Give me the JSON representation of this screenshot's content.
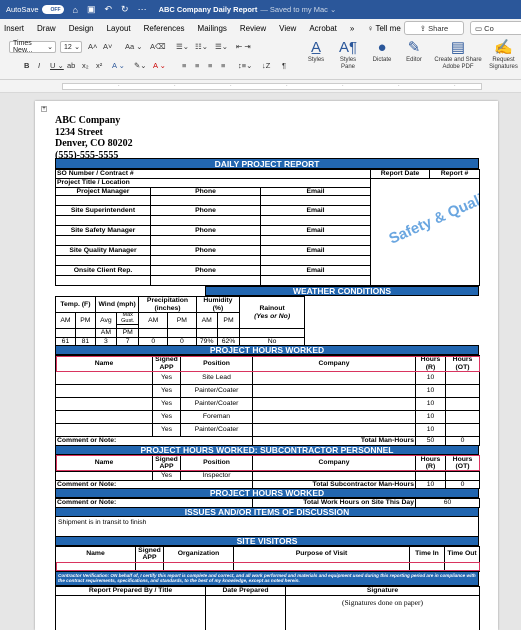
{
  "titlebar": {
    "autosave": "AutoSave",
    "autosave_state": "OFF",
    "doc_title": "ABC Company Daily Report",
    "saved_text": "— Saved to my Mac ⌄"
  },
  "menu": {
    "tabs": [
      "Insert",
      "Draw",
      "Design",
      "Layout",
      "References",
      "Mailings",
      "Review",
      "View",
      "Acrobat",
      "»",
      "Tell me"
    ],
    "share": "Share",
    "comments": "Co"
  },
  "ribbon": {
    "font_name": "Times New...",
    "font_size": "12",
    "styles": "Styles",
    "styles_pane": "Styles Pane",
    "dictate": "Dictate",
    "editor": "Editor",
    "create_share": "Create and Share Adobe PDF",
    "request": "Request Signatures"
  },
  "company": {
    "name": "ABC Company",
    "street": "1234 Street",
    "city": "Denver, CO 80202",
    "phone": "(555)-555-5555"
  },
  "report": {
    "title": "DAILY PROJECT REPORT",
    "so_label": "SO Number / Contract #",
    "report_date_label": "Report Date",
    "report_num_label": "Report #",
    "project_title_label": "Project Title / Location",
    "stamp": "Safety & Quality",
    "contacts": [
      {
        "role": "Project Manager",
        "phone": "Phone",
        "email": "Email"
      },
      {
        "role": "Site Superintendent",
        "phone": "Phone",
        "email": "Email"
      },
      {
        "role": "Site Safety Manager",
        "phone": "Phone",
        "email": "Email"
      },
      {
        "role": "Site Quality Manager",
        "phone": "Phone",
        "email": "Email"
      },
      {
        "role": "Onsite Client Rep.",
        "phone": "Phone",
        "email": "Email"
      }
    ]
  },
  "weather": {
    "title": "WEATHER CONDITIONS",
    "temp": "Temp. (F)",
    "wind": "Wind (mph)",
    "precip": "Precipitation (inches)",
    "humidity": "Humidity (%)",
    "rainout": "Rainout",
    "rainout_sub": "(Yes or No)",
    "am": "AM",
    "pm": "PM",
    "avg": "Avg",
    "max_gust": "Max Gust.",
    "values": [
      "61",
      "81",
      "3",
      "7",
      "0",
      "0",
      "79%",
      "62%",
      "No"
    ]
  },
  "hours": {
    "title": "PROJECT HOURS WORKED",
    "headers": [
      "Name",
      "Signed APP",
      "Position",
      "Company",
      "Hours (R)",
      "Hours (OT)"
    ],
    "rows": [
      {
        "signed": "Yes",
        "position": "Site Lead",
        "hours": "10"
      },
      {
        "signed": "Yes",
        "position": "Painter/Coater",
        "hours": "10"
      },
      {
        "signed": "Yes",
        "position": "Painter/Coater",
        "hours": "10"
      },
      {
        "signed": "Yes",
        "position": "Foreman",
        "hours": "10"
      },
      {
        "signed": "Yes",
        "position": "Painter/Coater",
        "hours": "10"
      }
    ],
    "comment": "Comment or Note:",
    "total_label": "Total Man-Hours",
    "total_r": "50",
    "total_ot": "0"
  },
  "sub": {
    "title": "PROJECT HOURS WORKED: SUBCONTRACTOR PERSONNEL",
    "row": {
      "signed": "Yes",
      "position": "Inspector",
      "hours": "10"
    },
    "comment": "Comment or Note:",
    "total_label": "Total Subcontractor Man-Hours",
    "total_r": "10",
    "total_ot": "0"
  },
  "hours2": {
    "title": "PROJECT HOURS WORKED",
    "comment": "Comment or Note:",
    "total_label": "Total Work Hours on Site This Day",
    "total": "60"
  },
  "issues": {
    "title": "ISSUES AND/OR ITEMS OF DISCUSSION",
    "text": "Shipment is in transit to finish"
  },
  "visitors": {
    "title": "SITE VISITORS",
    "headers": [
      "Name",
      "Signed APP",
      "Organization",
      "Purpose of Visit",
      "Time In",
      "Time Out"
    ]
  },
  "verification": "Contractor Verification: ON behalf of, I certify this report is complete and correct, and all work performed and materials and equipment used during this reporting period are in compliance with the contract requirements, specifications, and standards, to the best of my knowledge, except as noted herein.",
  "signoff": {
    "prepared_by": "Report Prepared By / Title",
    "date_prepared": "Date Prepared",
    "signature": "Signature",
    "sig_note": "(Signatures done on paper)"
  }
}
